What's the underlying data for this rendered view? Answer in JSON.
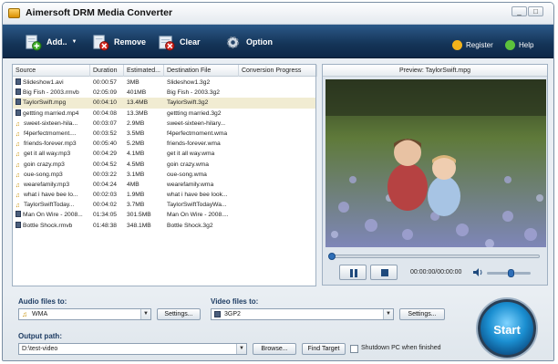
{
  "app": {
    "title": "Aimersoft DRM Media Converter",
    "window_buttons": [
      "_",
      "□",
      "✕"
    ]
  },
  "toolbar": {
    "add_label": "Add..",
    "remove_label": "Remove",
    "clear_label": "Clear",
    "option_label": "Option",
    "register_label": "Register",
    "help_label": "Help"
  },
  "file_list": {
    "columns": [
      "Source",
      "Duration",
      "Estimated...",
      "Destination File",
      "Conversion Progress"
    ],
    "rows": [
      {
        "type": "video",
        "source": "Slideshow1.avi",
        "duration": "00:00:57",
        "size": "3MB",
        "dest": "Slideshow1.3g2",
        "selected": false
      },
      {
        "type": "video",
        "source": "Big Fish - 2003.rmvb",
        "duration": "02:05:09",
        "size": "401MB",
        "dest": "Big Fish - 2003.3g2",
        "selected": false
      },
      {
        "type": "video",
        "source": "TaylorSwift.mpg",
        "duration": "00:04:10",
        "size": "13.4MB",
        "dest": "TaylorSwift.3g2",
        "selected": true
      },
      {
        "type": "video",
        "source": "gettting married.mp4",
        "duration": "00:04:08",
        "size": "13.3MB",
        "dest": "gettting married.3g2",
        "selected": false
      },
      {
        "type": "audio",
        "source": "sweet-sixteen-hila...",
        "duration": "00:03:07",
        "size": "2.9MB",
        "dest": "sweet-sixteen-hilary...",
        "selected": false
      },
      {
        "type": "audio",
        "source": "f4perfectmoment....",
        "duration": "00:03:52",
        "size": "3.5MB",
        "dest": "f4perfectmoment.wma",
        "selected": false
      },
      {
        "type": "audio",
        "source": "friends-forever.mp3",
        "duration": "00:05:40",
        "size": "5.2MB",
        "dest": "friends-forever.wma",
        "selected": false
      },
      {
        "type": "audio",
        "source": "get it all way.mp3",
        "duration": "00:04:29",
        "size": "4.1MB",
        "dest": "get it all way.wma",
        "selected": false
      },
      {
        "type": "audio",
        "source": "goin crazy.mp3",
        "duration": "00:04:52",
        "size": "4.5MB",
        "dest": "goin crazy.wma",
        "selected": false
      },
      {
        "type": "audio",
        "source": "oue-song.mp3",
        "duration": "00:03:22",
        "size": "3.1MB",
        "dest": "oue-song.wma",
        "selected": false
      },
      {
        "type": "audio",
        "source": "wearefamily.mp3",
        "duration": "00:04:24",
        "size": "4MB",
        "dest": "wearefamily.wma",
        "selected": false
      },
      {
        "type": "audio",
        "source": "what i have bee lo...",
        "duration": "00:02:03",
        "size": "1.9MB",
        "dest": "what i have bee look...",
        "selected": false
      },
      {
        "type": "audio",
        "source": "TaylorSwiftToday...",
        "duration": "00:04:02",
        "size": "3.7MB",
        "dest": "TaylorSwiftTodayWa...",
        "selected": false
      },
      {
        "type": "video",
        "source": "Man On Wire - 2008...",
        "duration": "01:34:05",
        "size": "301.5MB",
        "dest": "Man On Wire - 2008....",
        "selected": false
      },
      {
        "type": "video",
        "source": "Bottle Shock.rmvb",
        "duration": "01:48:38",
        "size": "348.1MB",
        "dest": "Bottle Shock.3g2",
        "selected": false
      }
    ]
  },
  "preview": {
    "title": "Preview: TaylorSwift.mpg",
    "time": "00:00:00/00:00:00",
    "playback_fraction": 0,
    "volume_fraction": 0.55
  },
  "bottom": {
    "audio_label": "Audio files to:",
    "audio_value": "WMA",
    "video_label": "Video files to:",
    "video_value": "3GP2",
    "settings_label": "Settings...",
    "output_label": "Output path:",
    "output_value": "D:\\test-video",
    "browse_label": "Browse...",
    "find_target_label": "Find Target",
    "shutdown_label": "Shutdown PC when finished",
    "start_label": "Start"
  },
  "colors": {
    "toolbar_bg": "#143457",
    "label_blue": "#1d3c63",
    "selected_row": "#f1ecd2",
    "start_blue": "#1b8fd1"
  }
}
